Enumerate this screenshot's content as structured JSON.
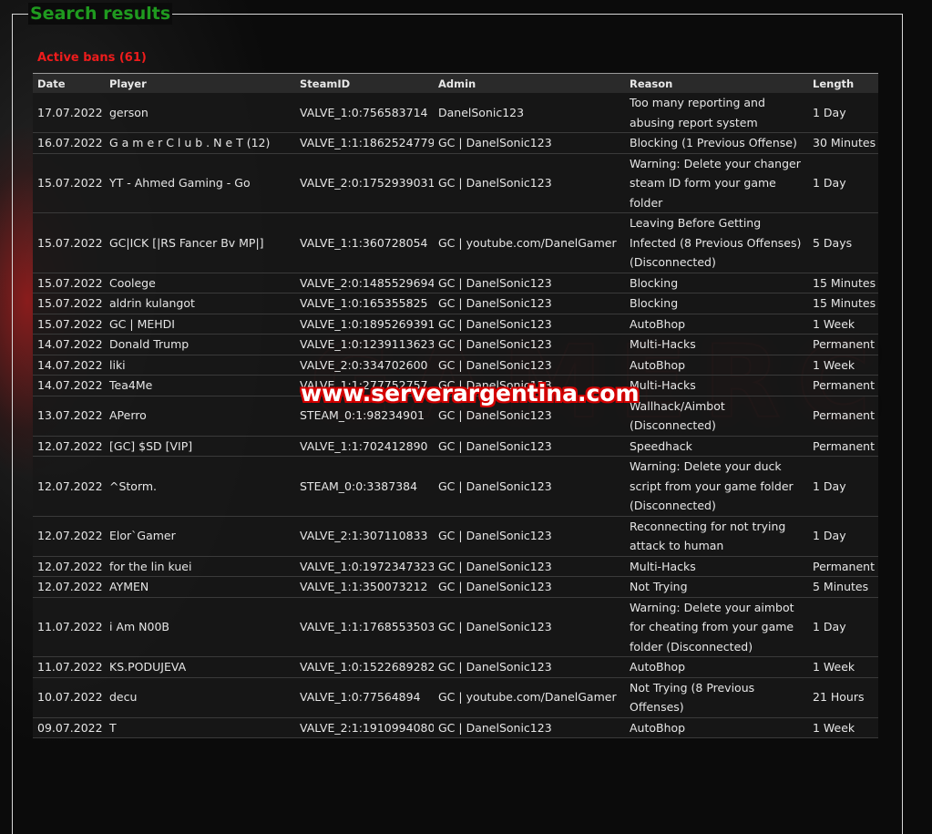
{
  "page": {
    "title": "Search results",
    "subtitle": "Active bans (61)",
    "watermark": "www.serverargentina.com"
  },
  "colors": {
    "title": "#1f9a1f",
    "subtitle": "#ee1c1c",
    "text": "#e6e6e6",
    "row_background": "#181818"
  },
  "table": {
    "columns": [
      "Date",
      "Player",
      "SteamID",
      "Admin",
      "Reason",
      "Length"
    ],
    "rows": [
      {
        "date": "17.07.2022",
        "player": "gerson",
        "steamid": "VALVE_1:0:756583714",
        "admin": "DanelSonic123",
        "reason": "Too many reporting and abusing report system",
        "length": "1 Day"
      },
      {
        "date": "16.07.2022",
        "player": "G a m e r C l u b . N e T (12)",
        "steamid": "VALVE_1:1:1862524779",
        "admin": "GC | DanelSonic123",
        "reason": "Blocking (1 Previous Offense)",
        "length": "30 Minutes"
      },
      {
        "date": "15.07.2022",
        "player": "YT - Ahmed Gaming - Go",
        "steamid": "VALVE_2:0:1752939031",
        "admin": "GC | DanelSonic123",
        "reason": "Warning: Delete your changer steam ID form your game folder",
        "length": "1 Day"
      },
      {
        "date": "15.07.2022",
        "player": "GC|ICK [|RS Fancer Bv MP|]",
        "steamid": "VALVE_1:1:360728054",
        "admin": "GC | youtube.com/DanelGamer",
        "reason": "Leaving Before Getting Infected (8 Previous Offenses) (Disconnected)",
        "length": "5 Days"
      },
      {
        "date": "15.07.2022",
        "player": "Coolege",
        "steamid": "VALVE_2:0:1485529694",
        "admin": "GC | DanelSonic123",
        "reason": "Blocking",
        "length": "15 Minutes"
      },
      {
        "date": "15.07.2022",
        "player": "aldrin kulangot",
        "steamid": "VALVE_1:0:165355825",
        "admin": "GC | DanelSonic123",
        "reason": "Blocking",
        "length": "15 Minutes"
      },
      {
        "date": "15.07.2022",
        "player": "GC | MEHDI",
        "steamid": "VALVE_1:0:1895269391",
        "admin": "GC | DanelSonic123",
        "reason": "AutoBhop",
        "length": "1 Week"
      },
      {
        "date": "14.07.2022",
        "player": "Donald Trump",
        "steamid": "VALVE_1:0:1239113623",
        "admin": "GC | DanelSonic123",
        "reason": "Multi-Hacks",
        "length": "Permanent"
      },
      {
        "date": "14.07.2022",
        "player": "liki",
        "steamid": "VALVE_2:0:334702600",
        "admin": "GC | DanelSonic123",
        "reason": "AutoBhop",
        "length": "1 Week"
      },
      {
        "date": "14.07.2022",
        "player": "Tea4Me",
        "steamid": "VALVE_1:1:277752757",
        "admin": "GC | DanelSonic123",
        "reason": "Multi-Hacks",
        "length": "Permanent"
      },
      {
        "date": "13.07.2022",
        "player": "APerro",
        "steamid": "STEAM_0:1:98234901",
        "admin": "GC | DanelSonic123",
        "reason": "Wallhack/Aimbot (Disconnected)",
        "length": "Permanent"
      },
      {
        "date": "12.07.2022",
        "player": "[GC] $SD [VIP]",
        "steamid": "VALVE_1:1:702412890",
        "admin": "GC | DanelSonic123",
        "reason": "Speedhack",
        "length": "Permanent"
      },
      {
        "date": "12.07.2022",
        "player": "^Storm.",
        "steamid": "STEAM_0:0:3387384",
        "admin": "GC | DanelSonic123",
        "reason": "Warning: Delete your duck script from your game folder (Disconnected)",
        "length": "1 Day"
      },
      {
        "date": "12.07.2022",
        "player": "Elor`Gamer",
        "steamid": "VALVE_2:1:307110833",
        "admin": "GC | DanelSonic123",
        "reason": "Reconnecting for not trying attack to human",
        "length": "1 Day"
      },
      {
        "date": "12.07.2022",
        "player": "for the lin kuei",
        "steamid": "VALVE_1:0:1972347323",
        "admin": "GC | DanelSonic123",
        "reason": "Multi-Hacks",
        "length": "Permanent"
      },
      {
        "date": "12.07.2022",
        "player": "AYMEN",
        "steamid": "VALVE_1:1:350073212",
        "admin": "GC | DanelSonic123",
        "reason": "Not Trying",
        "length": "5 Minutes"
      },
      {
        "date": "11.07.2022",
        "player": "i Am N00B",
        "steamid": "VALVE_1:1:1768553503",
        "admin": "GC | DanelSonic123",
        "reason": "Warning: Delete your aimbot for cheating from your game folder (Disconnected)",
        "length": "1 Day"
      },
      {
        "date": "11.07.2022",
        "player": "KS.PODUJEVA",
        "steamid": "VALVE_1:0:1522689282",
        "admin": "GC | DanelSonic123",
        "reason": "AutoBhop",
        "length": "1 Week"
      },
      {
        "date": "10.07.2022",
        "player": "decu",
        "steamid": "VALVE_1:0:77564894",
        "admin": "GC | youtube.com/DanelGamer",
        "reason": "Not Trying (8 Previous Offenses)",
        "length": "21 Hours"
      },
      {
        "date": "09.07.2022",
        "player": "T",
        "steamid": "VALVE_2:1:1910994080",
        "admin": "GC | DanelSonic123",
        "reason": "AutoBhop",
        "length": "1 Week"
      }
    ]
  }
}
